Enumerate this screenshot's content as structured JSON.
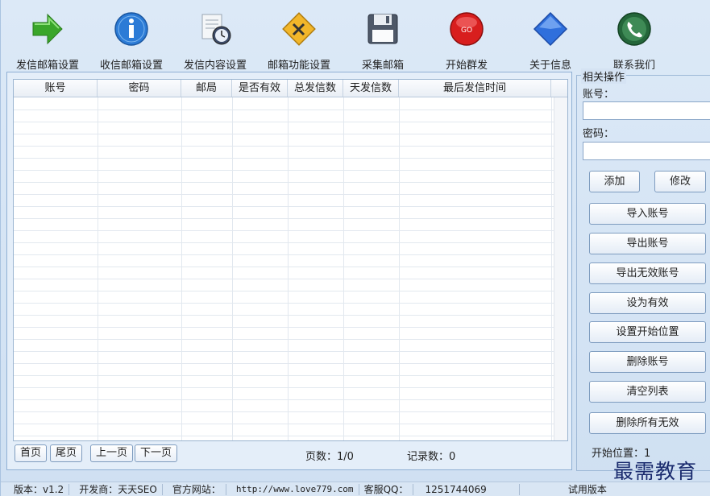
{
  "toolbar": [
    {
      "label": "发信邮箱设置",
      "icon": "green-arrow-icon"
    },
    {
      "label": "收信邮箱设置",
      "icon": "info-icon"
    },
    {
      "label": "发信内容设置",
      "icon": "document-clock-icon"
    },
    {
      "label": "邮箱功能设置",
      "icon": "tools-sign-icon"
    },
    {
      "label": "采集邮箱",
      "icon": "floppy-disk-icon"
    },
    {
      "label": "开始群发",
      "icon": "go-button-icon",
      "badge": "GO"
    },
    {
      "label": "关于信息",
      "icon": "blue-diamond-icon"
    },
    {
      "label": "联系我们",
      "icon": "phone-icon"
    }
  ],
  "table": {
    "columns": [
      "账号",
      "密码",
      "邮局",
      "是否有效",
      "总发信数",
      "天发信数",
      "最后发信时间"
    ],
    "rows": []
  },
  "pager": {
    "first": "首页",
    "last": "尾页",
    "prev": "上一页",
    "next": "下一页",
    "pages_label": "页数：",
    "pages_value": "1/0",
    "records_label": "记录数：",
    "records_value": "0"
  },
  "side": {
    "title": "相关操作",
    "account_label": "账号：",
    "account_value": "",
    "password_label": "密码：",
    "password_value": "",
    "add": "添加",
    "modify": "修改",
    "actions": [
      "导入账号",
      "导出账号",
      "导出无效账号",
      "设为有效",
      "设置开始位置",
      "删除账号",
      "清空列表",
      "删除所有无效"
    ],
    "start_pos_label": "开始位置：",
    "start_pos_value": "1"
  },
  "status": {
    "version": "版本：v1.2",
    "developer": "开发商：天天SEO",
    "site_label": "官方网站：",
    "site_url": "http://www.love779.com",
    "qq_label": "客服QQ：",
    "qq_value": "1251744069",
    "edition": "试用版本"
  },
  "watermark": "最需教育",
  "colors": {
    "background": "#d6e4f3",
    "accent": "#1a2b6e"
  }
}
